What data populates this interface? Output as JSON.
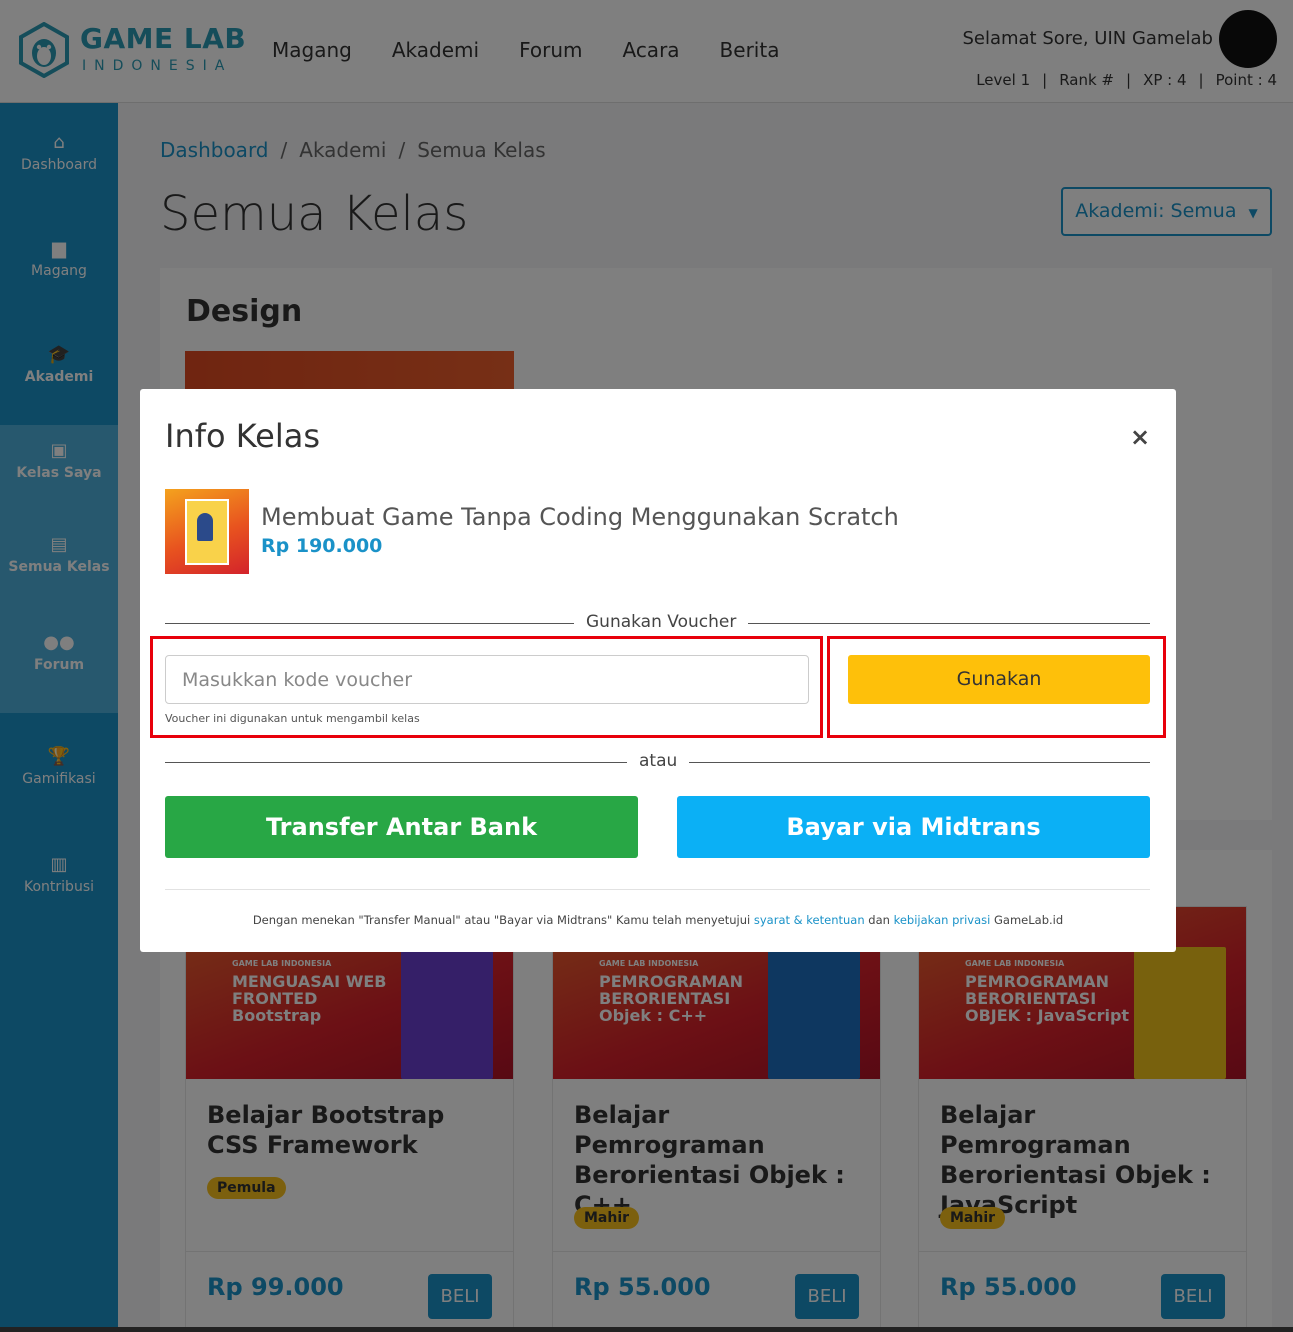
{
  "header": {
    "logo_title": "GAME LAB",
    "logo_subtitle": "INDONESIA",
    "nav": [
      "Magang",
      "Akademi",
      "Forum",
      "Acara",
      "Berita"
    ],
    "greeting": "Selamat Sore, UIN Gamelab",
    "stats": {
      "level": "Level 1",
      "rank": "Rank #",
      "xp": "XP : 4",
      "point": "Point : 4"
    }
  },
  "sidebar": {
    "items": [
      {
        "label": "Dashboard",
        "icon": "home-icon",
        "glyph": "⌂"
      },
      {
        "label": "Magang",
        "icon": "briefcase-icon",
        "glyph": "▆"
      },
      {
        "label": "Akademi",
        "icon": "graduation-cap-icon",
        "glyph": "🎓"
      },
      {
        "label": "Kelas Saya",
        "icon": "id-badge-icon",
        "glyph": "▣"
      },
      {
        "label": "Semua Kelas",
        "icon": "list-icon",
        "glyph": "▤"
      },
      {
        "label": "Forum",
        "icon": "users-icon",
        "glyph": "●●"
      },
      {
        "label": "Gamifikasi",
        "icon": "trophy-icon",
        "glyph": "🏆"
      },
      {
        "label": "Kontribusi",
        "icon": "book-icon",
        "glyph": "▥"
      }
    ]
  },
  "breadcrumb": {
    "home": "Dashboard",
    "level2": "Akademi",
    "current": "Semua Kelas"
  },
  "page_title": "Semua Kelas",
  "filter_label": "Akademi: Semua",
  "section_title": "Design",
  "cards": [
    {
      "brand": "GAME LAB INDONESIA",
      "thumb_title": "MENGUASAI WEB FRONTED Bootstrap",
      "name": "Belajar Bootstrap CSS Framework",
      "level": "Pemula",
      "price": "Rp 99.000",
      "buy": "BELI",
      "box_color": "#6b3fd1"
    },
    {
      "brand": "GAME LAB INDONESIA",
      "thumb_title": "PEMROGRAMAN BERORIENTASI Objek : C++",
      "name": "Belajar Pemrograman Berorientasi Objek : C++",
      "level": "Mahir",
      "price": "Rp 55.000",
      "buy": "BELI",
      "box_color": "#1c6fc1"
    },
    {
      "brand": "GAME LAB INDONESIA",
      "thumb_title": "PEMROGRAMAN BERORIENTASI OBJEK : JavaScript",
      "name": "Belajar Pemrograman Berorientasi Objek : JavaScript",
      "level": "Mahir",
      "price": "Rp 55.000",
      "buy": "BELI",
      "box_color": "#f1c21b"
    }
  ],
  "modal": {
    "title": "Info Kelas",
    "close": "×",
    "course_name": "Membuat Game Tanpa Coding Menggunakan Scratch",
    "course_price": "Rp 190.000",
    "voucher_divider": "Gunakan Voucher",
    "voucher_placeholder": "Masukkan kode voucher",
    "voucher_value": "",
    "voucher_hint": "Voucher ini digunakan untuk mengambil kelas",
    "voucher_button": "Gunakan",
    "or_divider": "atau",
    "transfer_button": "Transfer Antar Bank",
    "midtrans_button": "Bayar via Midtrans",
    "terms_prefix": "Dengan menekan \"Transfer Manual\" atau \"Bayar via Midtrans\" Kamu telah menyetujui",
    "terms_link1": "syarat & ketentuan",
    "terms_mid": "dan",
    "terms_link2": "kebijakan privasi",
    "terms_suffix": "GameLab.id"
  },
  "colors": {
    "brand_blue": "#1a92c8",
    "voucher_yellow": "#fec00a",
    "transfer_green": "#28a745",
    "midtrans_blue": "#0bb0f5",
    "highlight_red": "#e8000b"
  }
}
